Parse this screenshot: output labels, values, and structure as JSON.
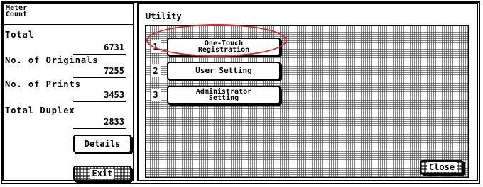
{
  "meter": {
    "title_line1": "Meter",
    "title_line2": "Count",
    "counters": [
      {
        "label": "Total",
        "value": "6731"
      },
      {
        "label": "No. of Originals",
        "value": "7255"
      },
      {
        "label": "No. of Prints",
        "value": "3453"
      },
      {
        "label": "Total Duplex",
        "value": "2833"
      }
    ],
    "details_label": "Details",
    "exit_label": "Exit"
  },
  "utility": {
    "title": "Utility",
    "items": [
      {
        "number": "1",
        "line1": "One-Touch",
        "line2": "Registration"
      },
      {
        "number": "2",
        "label": "User Setting"
      },
      {
        "number": "3",
        "line1": "Administrator",
        "line2": "Setting"
      }
    ],
    "close_label": "Close"
  },
  "colors": {
    "highlight": "#d42626",
    "ink": "#000000",
    "background": "#ffffff"
  }
}
